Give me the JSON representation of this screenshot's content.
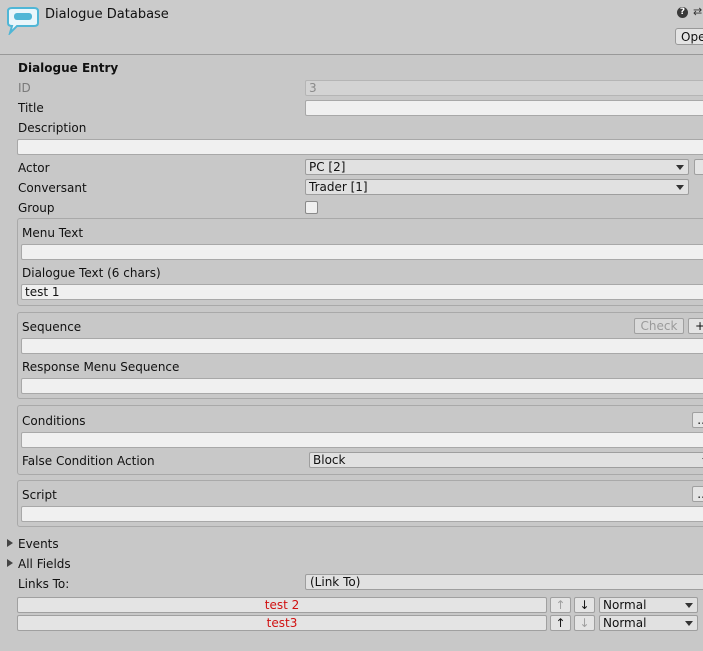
{
  "header": {
    "title": "Dialogue Database",
    "open_label": "Ope"
  },
  "entry": {
    "heading": "Dialogue Entry",
    "id_label": "ID",
    "id_value": "3",
    "title_label": "Title",
    "title_value": "",
    "description_label": "Description",
    "description_value": "",
    "actor_label": "Actor",
    "actor_value": "PC [2]",
    "conversant_label": "Conversant",
    "conversant_value": "Trader [1]",
    "group_label": "Group"
  },
  "text_section": {
    "menu_text_label": "Menu Text",
    "menu_text_value": "",
    "dialogue_text_label": "Dialogue Text (6 chars)",
    "dialogue_text_value": "test 1"
  },
  "sequence_section": {
    "sequence_label": "Sequence",
    "check_label": "Check",
    "plus_label": "+",
    "sequence_value": "",
    "response_menu_label": "Response Menu Sequence",
    "response_menu_value": ""
  },
  "conditions_section": {
    "conditions_label": "Conditions",
    "ellipsis_label": "...",
    "conditions_value": "",
    "false_action_label": "False Condition Action",
    "false_action_value": "Block"
  },
  "script_section": {
    "script_label": "Script",
    "ellipsis_label": "...",
    "script_value": ""
  },
  "foldouts": {
    "events_label": "Events",
    "all_fields_label": "All Fields"
  },
  "links": {
    "links_to_label": "Links To:",
    "link_to_value": "(Link To)",
    "items": [
      {
        "label": "test 2",
        "up": "↑",
        "down": "↓",
        "priority": "Normal"
      },
      {
        "label": "test3",
        "up": "↑",
        "down": "↓",
        "priority": "Normal"
      }
    ]
  },
  "colors": {
    "background": "#c8c8c8",
    "link_text": "#d01010",
    "logo": "#4fb6d6"
  },
  "icons": [
    "speech-bubble-logo-icon",
    "help-icon",
    "settings-icon",
    "dropdown-arrow-icon",
    "foldout-arrow-icon",
    "arrow-up-icon",
    "arrow-down-icon"
  ]
}
